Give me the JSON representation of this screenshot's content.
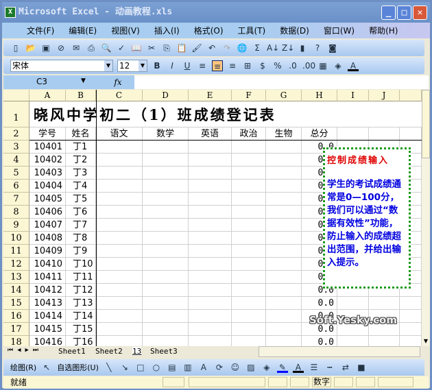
{
  "window": {
    "title": "Microsoft Excel - 动画教程.xls",
    "minimize": "_",
    "maximize": "□",
    "close": "✕"
  },
  "menu": [
    "文件(F)",
    "编辑(E)",
    "视图(V)",
    "插入(I)",
    "格式(O)",
    "工具(T)",
    "数据(D)",
    "窗口(W)",
    "帮助(H)"
  ],
  "format_toolbar": {
    "font": "宋体",
    "size": "12",
    "bold": "B",
    "italic": "I",
    "underline": "U",
    "percent": "%"
  },
  "formula_bar": {
    "name_box": "C3",
    "fx": "fx",
    "value": ""
  },
  "columns": [
    "A",
    "B",
    "C",
    "D",
    "E",
    "F",
    "G",
    "H",
    "I",
    "J"
  ],
  "sheet": {
    "title": "晓风中学初二（1）班成绩登记表",
    "headers": [
      "学号",
      "姓名",
      "语文",
      "数学",
      "英语",
      "政治",
      "生物",
      "总分"
    ],
    "rows": [
      [
        "3",
        "10401",
        "丁1",
        "0.0"
      ],
      [
        "4",
        "10402",
        "丁2",
        "0.0"
      ],
      [
        "5",
        "10403",
        "丁3",
        "0.0"
      ],
      [
        "6",
        "10404",
        "丁4",
        "0.0"
      ],
      [
        "7",
        "10405",
        "丁5",
        "0.0"
      ],
      [
        "8",
        "10406",
        "丁6",
        "0.0"
      ],
      [
        "9",
        "10407",
        "丁7",
        "0.0"
      ],
      [
        "10",
        "10408",
        "丁8",
        "0.0"
      ],
      [
        "11",
        "10409",
        "丁9",
        "0.0"
      ],
      [
        "12",
        "10410",
        "丁10",
        "0.0"
      ],
      [
        "13",
        "10411",
        "丁11",
        "0.0"
      ],
      [
        "14",
        "10412",
        "丁12",
        "0.0"
      ],
      [
        "15",
        "10413",
        "丁13",
        "0.0"
      ],
      [
        "16",
        "10414",
        "丁14",
        "0.0"
      ],
      [
        "17",
        "10415",
        "丁15",
        "0.0"
      ],
      [
        "18",
        "10416",
        "丁16",
        "0.0"
      ]
    ]
  },
  "note": {
    "title": "控制成绩输入",
    "body": "学生的考试成绩通常是0—100分，我们可以通过“数据有效性”功能，防止输入的成绩超出范围，并给出输入提示。"
  },
  "sheet_tabs": [
    "Sheet1",
    "Sheet2",
    "13",
    "Sheet3"
  ],
  "active_tab": "13",
  "draw_toolbar": {
    "draw": "绘图(R)",
    "autoshapes": "自选图形(U)"
  },
  "status": {
    "ready": "就绪",
    "num": "数字"
  },
  "watermark": "Soft.Yesky.com"
}
